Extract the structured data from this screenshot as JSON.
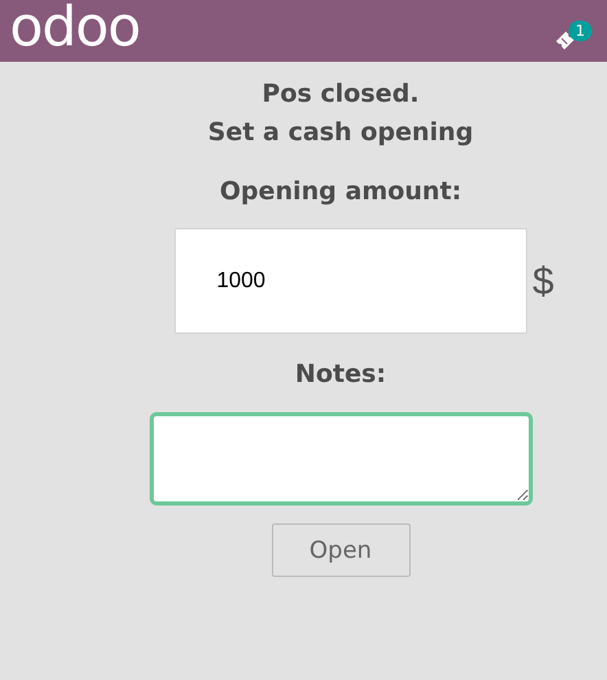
{
  "header": {
    "logo": "odoo",
    "ticket_badge": "1"
  },
  "title_lines": [
    "Pos closed.",
    "Set a cash opening"
  ],
  "opening_amount": {
    "label": "Opening amount:",
    "value": "1000",
    "currency": "$"
  },
  "notes": {
    "label": "Notes:"
  },
  "open_button": "Open"
}
